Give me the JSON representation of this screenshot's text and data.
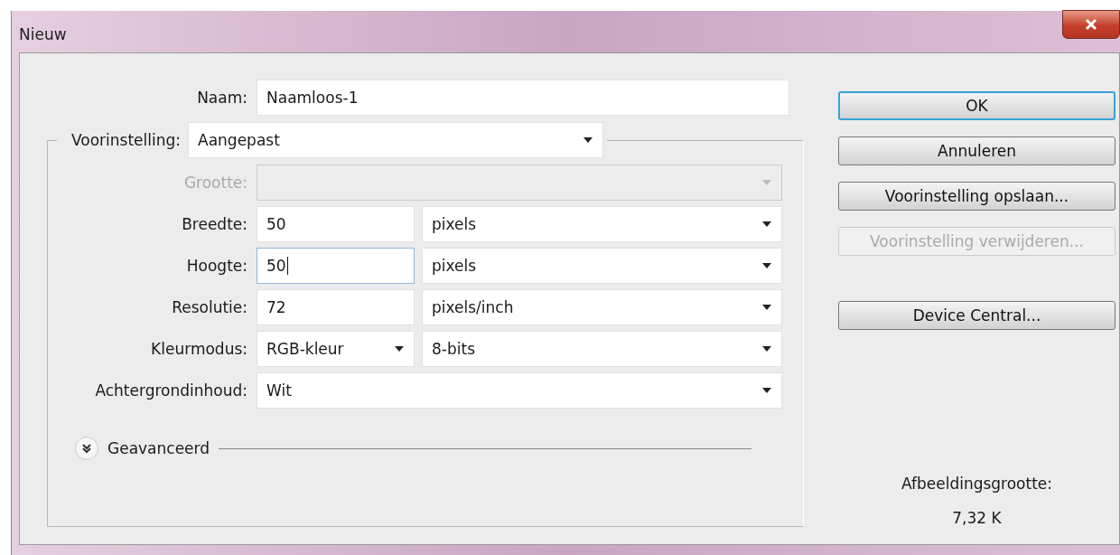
{
  "window": {
    "title": "Nieuw"
  },
  "name": {
    "label": "Naam:",
    "value": "Naamloos-1"
  },
  "preset": {
    "label": "Voorinstelling:",
    "value": "Aangepast"
  },
  "rows": [
    {
      "label": "Grootte:",
      "disabled": true,
      "fields": [
        {
          "kind": "select",
          "focused": false
        }
      ]
    },
    {
      "label": "Breedte:",
      "disabled": false,
      "fields": [
        {
          "kind": "text",
          "value": "50",
          "focused": false
        },
        {
          "kind": "select",
          "value": "pixels",
          "focused": false
        }
      ]
    },
    {
      "label": "Hoogte:",
      "disabled": false,
      "fields": [
        {
          "kind": "text",
          "value": "50",
          "focused": true
        },
        {
          "kind": "select",
          "value": "pixels",
          "focused": false
        }
      ]
    },
    {
      "label": "Resolutie:",
      "disabled": false,
      "fields": [
        {
          "kind": "text",
          "value": "72",
          "focused": false
        },
        {
          "kind": "select",
          "value": "pixels/inch",
          "focused": false
        }
      ]
    },
    {
      "label": "Kleurmodus:",
      "disabled": false,
      "fields": [
        {
          "kind": "select",
          "value": "RGB-kleur",
          "focused": false
        },
        {
          "kind": "select",
          "value": "8-bits",
          "focused": false
        }
      ]
    },
    {
      "label": "Achtergrondinhoud:",
      "disabled": false,
      "fields": [
        {
          "kind": "select",
          "value": "Wit",
          "focused": false
        }
      ]
    }
  ],
  "advanced": {
    "label": "Geavanceerd",
    "expanded": false
  },
  "buttons": [
    {
      "label": "OK",
      "default": true,
      "disabled": false
    },
    {
      "label": "Annuleren",
      "default": false,
      "disabled": false
    },
    {
      "label": "Voorinstelling opslaan...",
      "default": false,
      "disabled": false
    },
    {
      "label": "Voorinstelling verwijderen...",
      "default": false,
      "disabled": true
    },
    {
      "label": "Device Central...",
      "default": false,
      "disabled": false
    }
  ],
  "image_size": {
    "label": "Afbeeldingsgrootte:",
    "value": "7,32 K"
  }
}
